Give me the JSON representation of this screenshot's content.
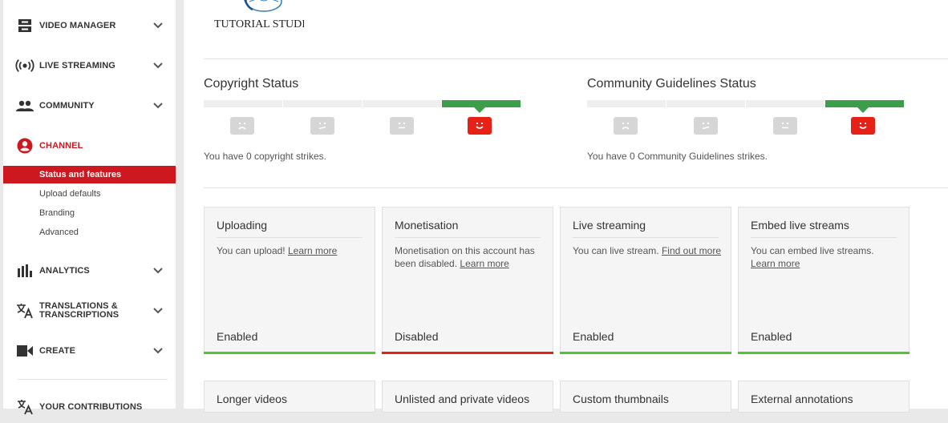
{
  "sidebar": {
    "items": [
      {
        "label": "VIDEO MANAGER",
        "icon": "video-manager-icon"
      },
      {
        "label": "LIVE STREAMING",
        "icon": "live-streaming-icon"
      },
      {
        "label": "COMMUNITY",
        "icon": "community-icon"
      },
      {
        "label": "CHANNEL",
        "icon": "channel-icon"
      },
      {
        "label": "ANALYTICS",
        "icon": "analytics-icon"
      },
      {
        "label": "TRANSLATIONS & TRANSCRIPTIONS",
        "icon": "translations-icon"
      },
      {
        "label": "CREATE",
        "icon": "create-icon"
      },
      {
        "label": "YOUR CONTRIBUTIONS",
        "icon": "contributions-icon"
      }
    ],
    "channel_sub": [
      {
        "label": "Status and features"
      },
      {
        "label": "Upload defaults"
      },
      {
        "label": "Branding"
      },
      {
        "label": "Advanced"
      }
    ]
  },
  "logo": {
    "text": "TUTORIAL STUDIO"
  },
  "copyright": {
    "title": "Copyright Status",
    "text": "You have 0 copyright strikes."
  },
  "community": {
    "title": "Community Guidelines Status",
    "text": "You have 0 Community Guidelines strikes."
  },
  "cards": [
    {
      "title": "Uploading",
      "desc": "You can upload!",
      "link": "Learn more",
      "state": "Enabled"
    },
    {
      "title": "Monetisation",
      "desc": "Monetisation on this account has been disabled.",
      "link": "Learn more",
      "state": "Disabled"
    },
    {
      "title": "Live streaming",
      "desc": "You can live stream.",
      "link": "Find out more",
      "state": "Enabled"
    },
    {
      "title": "Embed live streams",
      "desc": "You can embed live streams.",
      "link": "Learn more",
      "state": "Enabled"
    },
    {
      "title": "Longer videos"
    },
    {
      "title": "Unlisted and private videos"
    },
    {
      "title": "Custom thumbnails"
    },
    {
      "title": "External annotations"
    }
  ],
  "colors": {
    "accent": "#cc181e",
    "enabled": "#4cca2a",
    "disabled": "#e62117",
    "status_green": "#3c9e4b"
  }
}
